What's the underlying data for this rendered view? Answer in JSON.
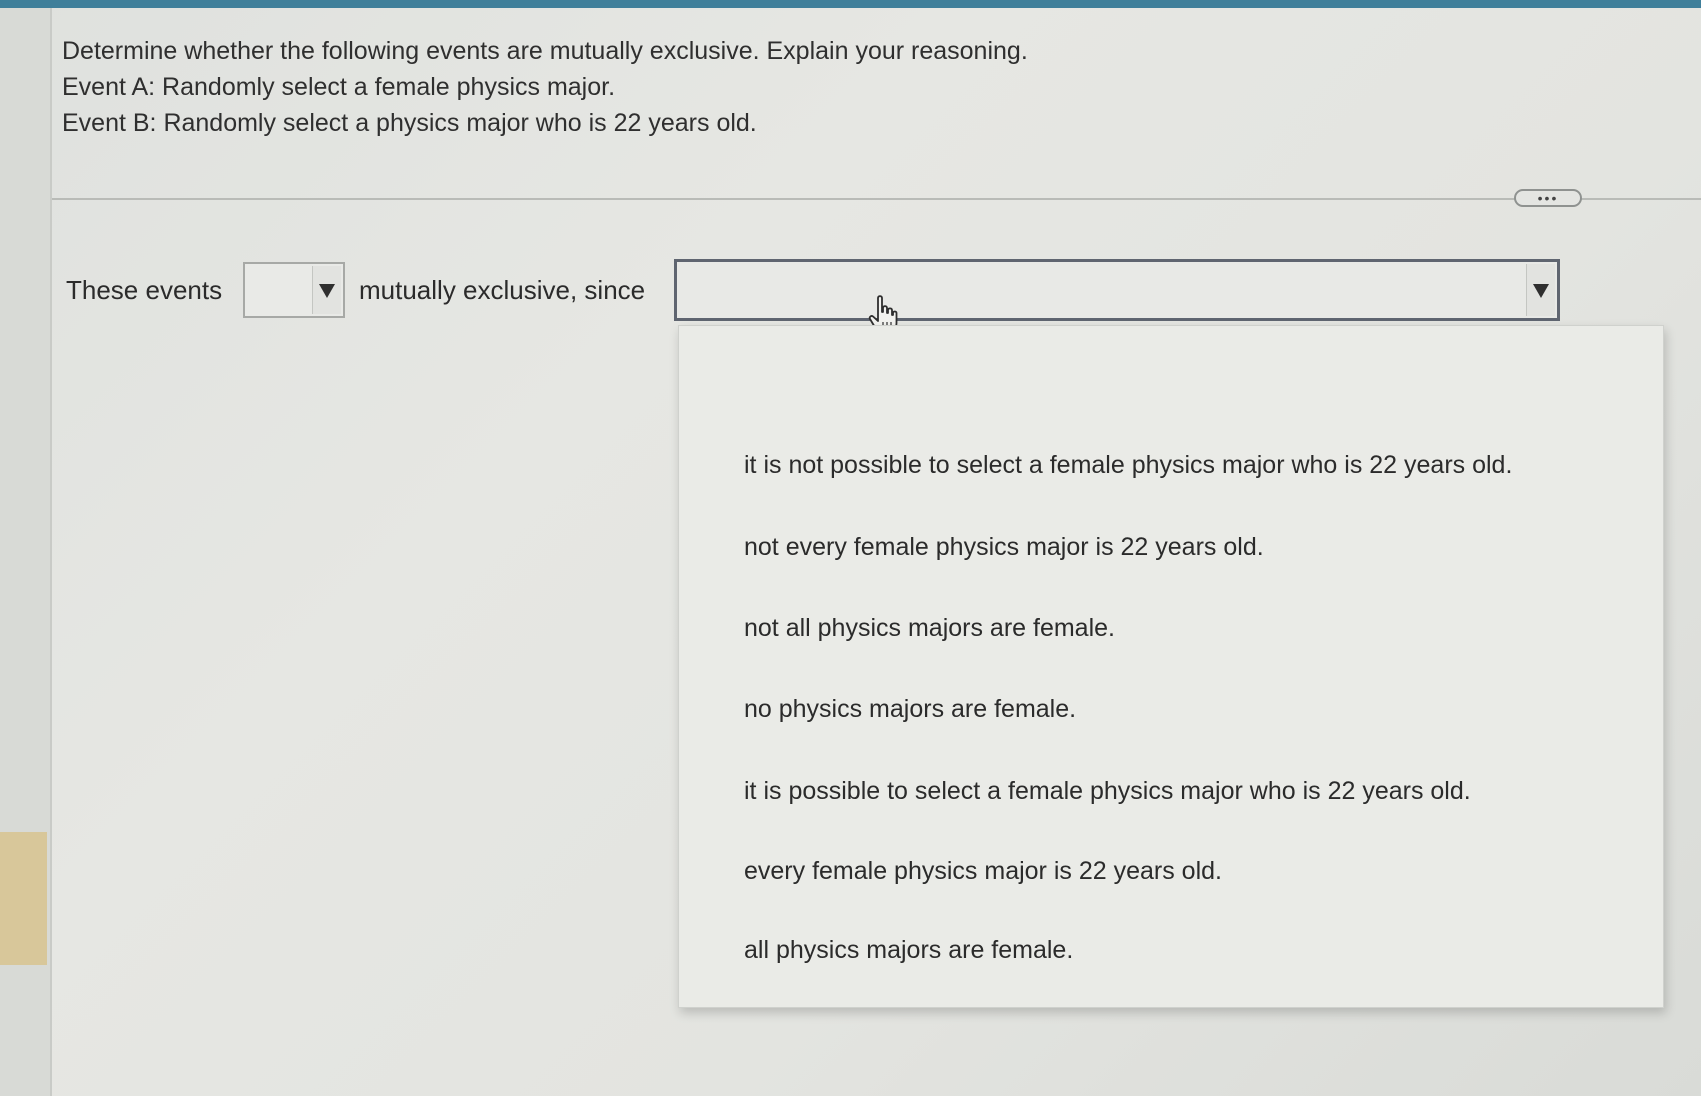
{
  "question": {
    "prompt": "Determine whether the following events are mutually exclusive. Explain your reasoning.",
    "event_a": "Event A: Randomly select a female physics major.",
    "event_b": "Event B: Randomly select a physics major who is 22 years old."
  },
  "toolbar": {
    "more_label": "•••"
  },
  "answer": {
    "prefix": "These events",
    "middle": "mutually exclusive, since",
    "first_select_value": "",
    "second_select_value": ""
  },
  "dropdown": {
    "options": [
      "it is not possible to select a female physics major who is 22 years old.",
      "not every female physics major is 22 years old.",
      "not all physics majors are female.",
      "no physics majors are female.",
      "it is possible to select a female physics major who is 22 years old.",
      "every female physics major is 22 years old.",
      "all physics majors are female."
    ]
  },
  "icons": {
    "dropdown_arrow": "chevron-down-icon",
    "cursor": "hand-pointer-icon"
  },
  "colors": {
    "top_bar": "#3f7f9a",
    "active_select_border": "#5f6570",
    "left_accent": "#d8c79a"
  }
}
